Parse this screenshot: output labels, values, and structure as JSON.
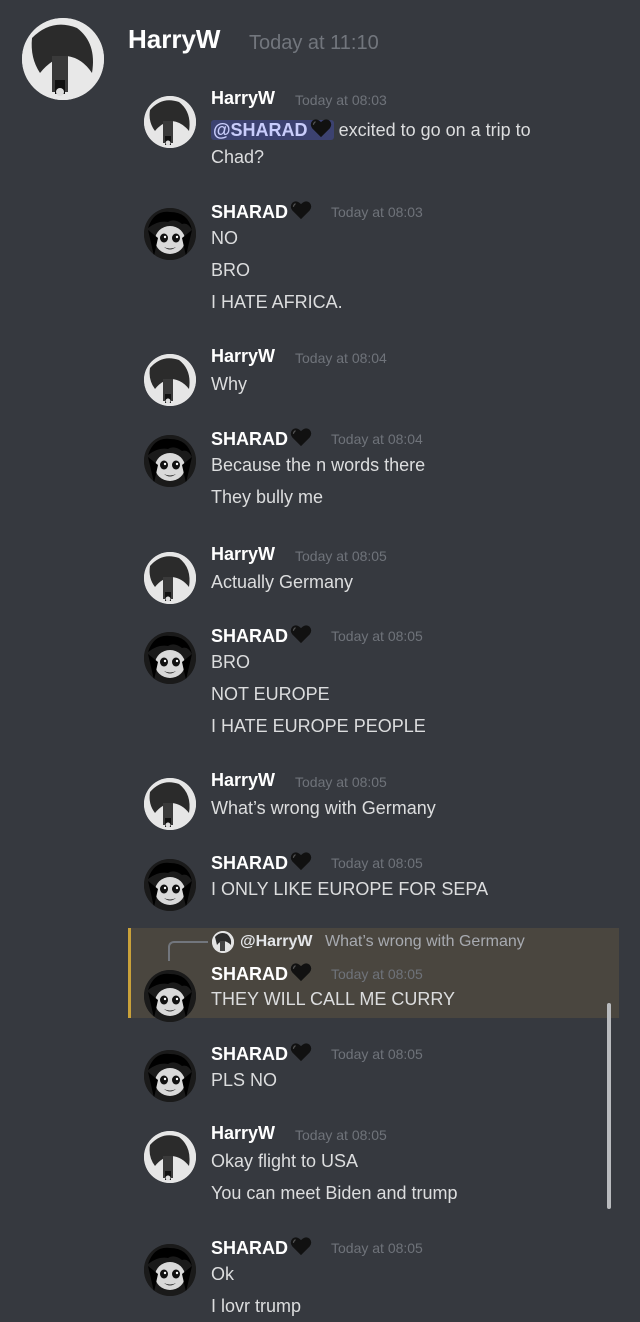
{
  "header": {
    "name": "HarryW",
    "time": "Today at 11:10"
  },
  "messages": [
    {
      "user": "HarryW",
      "heart": false,
      "time": "Today at 08:03",
      "mention": "@SHARAD",
      "lines": [
        "excited to go on a trip to",
        "Chad?"
      ]
    },
    {
      "user": "SHARAD",
      "heart": true,
      "time": "Today at 08:03",
      "lines": [
        "NO",
        "BRO",
        "I HATE AFRICA."
      ]
    },
    {
      "user": "HarryW",
      "heart": false,
      "time": "Today at 08:04",
      "lines": [
        "Why"
      ]
    },
    {
      "user": "SHARAD",
      "heart": true,
      "time": "Today at 08:04",
      "lines": [
        "Because the n words there",
        "They bully me"
      ]
    },
    {
      "user": "HarryW",
      "heart": false,
      "time": "Today at 08:05",
      "lines": [
        "Actually Germany"
      ]
    },
    {
      "user": "SHARAD",
      "heart": true,
      "time": "Today at 08:05",
      "lines": [
        "BRO",
        "NOT EUROPE",
        "I HATE EUROPE PEOPLE"
      ]
    },
    {
      "user": "HarryW",
      "heart": false,
      "time": "Today at 08:05",
      "lines": [
        "What’s wrong with Germany"
      ]
    },
    {
      "user": "SHARAD",
      "heart": true,
      "time": "Today at 08:05",
      "lines": [
        "I ONLY LIKE EUROPE FOR SEPA"
      ]
    },
    {
      "user": "SHARAD",
      "heart": true,
      "time": "Today at 08:05",
      "lines": [
        "THEY WILL CALL ME CURRY"
      ]
    },
    {
      "user": "SHARAD",
      "heart": true,
      "time": "Today at 08:05",
      "lines": [
        "PLS NO"
      ]
    },
    {
      "user": "HarryW",
      "heart": false,
      "time": "Today at 08:05",
      "lines": [
        "Okay flight to USA",
        "You can meet Biden and trump"
      ]
    },
    {
      "user": "SHARAD",
      "heart": true,
      "time": "Today at 08:05",
      "lines": [
        "Ok",
        "I lovr trump"
      ]
    }
  ],
  "reply": {
    "name": "@HarryW",
    "text": "What’s wrong with Germany"
  },
  "colors": {
    "background": "#36393f",
    "mention_bg": "#3c4270",
    "reply_highlight": "#4a463f",
    "reply_bar": "#c9a13a"
  }
}
